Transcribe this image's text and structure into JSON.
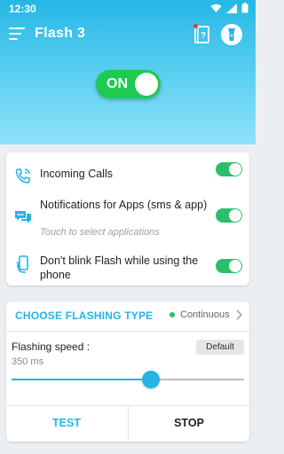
{
  "status_bar": {
    "time": "12:30"
  },
  "app_bar": {
    "title": "Flash 3"
  },
  "master_switch": {
    "label": "ON",
    "state": "on"
  },
  "options": [
    {
      "title": "Incoming Calls",
      "subtitle": "",
      "enabled": true,
      "icon": "phone-ringing-icon"
    },
    {
      "title": "Notifications for Apps (sms & app)",
      "subtitle": "Touch to select applications",
      "enabled": true,
      "icon": "chat-bubbles-icon"
    },
    {
      "title": "Don't blink Flash while using the phone",
      "subtitle": "",
      "enabled": true,
      "icon": "hand-phone-icon"
    }
  ],
  "flash": {
    "type_label": "CHOOSE FLASHING TYPE",
    "type_value": "Continuous",
    "speed_label": "Flashing speed :",
    "speed_value": "350 ms",
    "speed_fraction": 0.6,
    "default_label": "Default",
    "test_label": "TEST",
    "stop_label": "STOP"
  },
  "colors": {
    "accent": "#27b4e4",
    "toggle_green": "#1ccb50",
    "switch_green": "#2bbf6a"
  }
}
